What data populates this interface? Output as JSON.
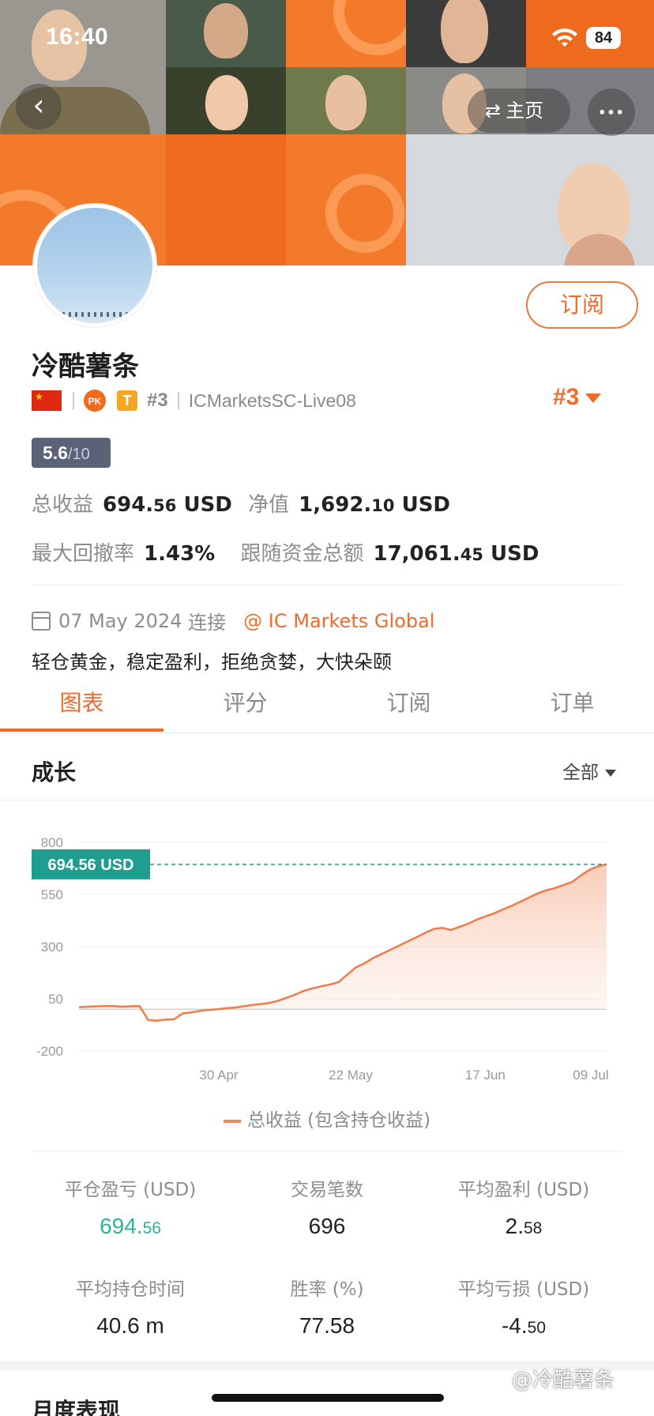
{
  "status": {
    "time": "16:40",
    "battery": "84"
  },
  "nav": {
    "back_glyph": "‹",
    "home_label": "主页",
    "swap_glyph": "⇄",
    "more_glyph": "•••"
  },
  "profile": {
    "name": "冷酷薯条",
    "pk_label": "PK",
    "t_label": "T",
    "rank_small": "#3",
    "server": "ICMarketsSC-Live08",
    "rank": "#3",
    "subscribe_label": "订阅",
    "score": "5.6",
    "score_den": "/10"
  },
  "stats": {
    "total_profit_label": "总收益",
    "total_profit_main": "694.",
    "total_profit_dec": "56",
    "total_profit_unit": "USD",
    "net_label": "净值",
    "net_main": "1,692.",
    "net_dec": "10",
    "net_unit": "USD",
    "drawdown_label": "最大回撤率",
    "drawdown_value": "1.43%",
    "follow_label": "跟随资金总额",
    "follow_main": "17,061.",
    "follow_dec": "45",
    "follow_unit": "USD"
  },
  "connection": {
    "date": "07 May 2024",
    "suffix": "连接",
    "broker": "@ IC Markets Global"
  },
  "motto": "轻仓黄金，稳定盈利，拒绝贪婪，大快朵颐",
  "tabs": [
    {
      "label": "图表",
      "active": true
    },
    {
      "label": "评分",
      "active": false
    },
    {
      "label": "订阅",
      "active": false
    },
    {
      "label": "订单",
      "active": false
    }
  ],
  "growth": {
    "title": "成长",
    "filter": "全部"
  },
  "chart_data": {
    "type": "area",
    "y_ticks": [
      "800",
      "550",
      "300",
      "50",
      "-200"
    ],
    "x_ticks": [
      "30 Apr",
      "22 May",
      "17 Jun",
      "09 Jul"
    ],
    "ylim": [
      -200,
      800
    ],
    "current_label": "694.56 USD",
    "current_value": 694.56,
    "series": [
      {
        "name": "总收益 (包含持仓收益)",
        "values": [
          10,
          12,
          14,
          15,
          15,
          12,
          14,
          15,
          -52,
          -55,
          -50,
          -48,
          -20,
          -15,
          -8,
          -3,
          0,
          5,
          8,
          14,
          20,
          25,
          30,
          40,
          55,
          70,
          88,
          100,
          110,
          118,
          130,
          165,
          200,
          220,
          245,
          265,
          285,
          305,
          325,
          345,
          365,
          385,
          390,
          380,
          395,
          410,
          430,
          445,
          460,
          478,
          495,
          515,
          535,
          555,
          570,
          580,
          595,
          610,
          640,
          668,
          685,
          694.56
        ]
      }
    ],
    "grid": true
  },
  "legend": {
    "label": "总收益 (包含持仓收益)"
  },
  "kpis": [
    {
      "label": "平仓盈亏 (USD)",
      "main": "694.",
      "dec": "56",
      "green": true
    },
    {
      "label": "交易笔数",
      "main": "696",
      "dec": "",
      "green": false
    },
    {
      "label": "平均盈利 (USD)",
      "main": "2.",
      "dec": "58",
      "green": false
    },
    {
      "label": "平均持仓时间",
      "main": "40.6 m",
      "dec": "",
      "green": false
    },
    {
      "label": "胜率 (%)",
      "main": "77.58",
      "dec": "",
      "green": false
    },
    {
      "label": "平均亏损 (USD)",
      "main": "-4.",
      "dec": "50",
      "green": false
    }
  ],
  "monthly_title": "月度表现",
  "watermark": "@冷酷薯条",
  "colors": {
    "accent": "#ef6b2c",
    "green": "#2db39a",
    "teal_label": "#1f9e8f"
  }
}
